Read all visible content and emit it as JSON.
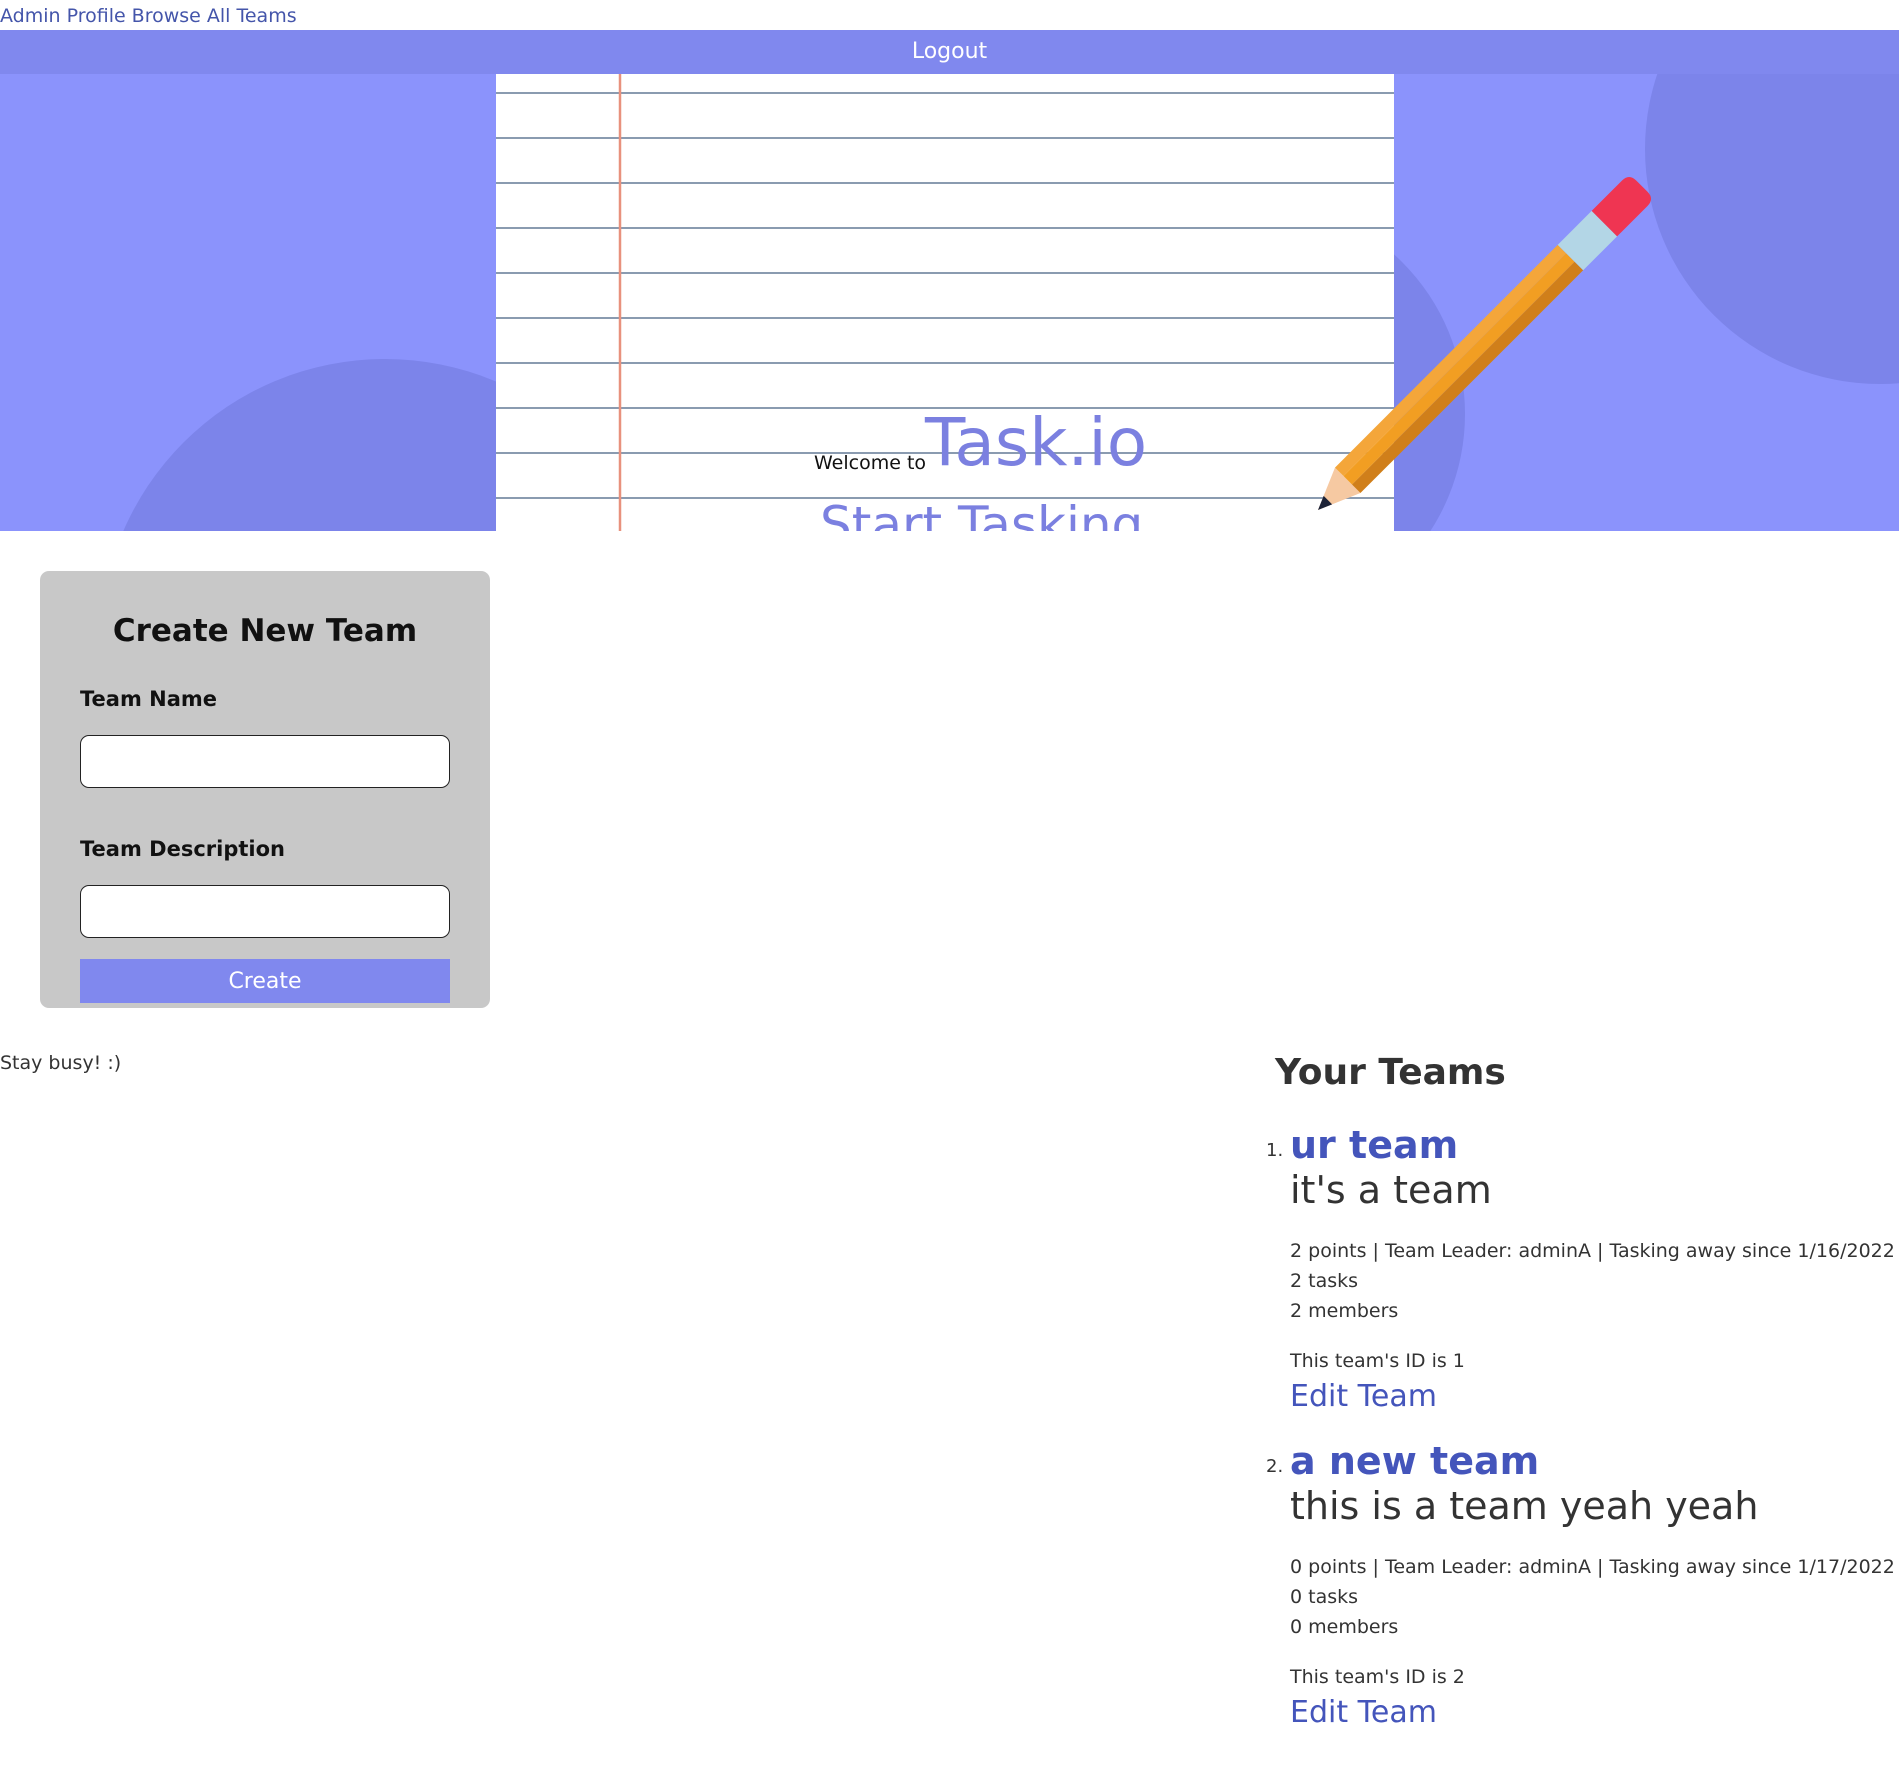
{
  "nav": {
    "profile_label": "Admin Profile",
    "browse_label": "Browse All Teams",
    "logout_label": "Logout"
  },
  "hero": {
    "welcome": "Welcome to",
    "brand": "Task.io",
    "tagline": "Start Tasking"
  },
  "form": {
    "title": "Create New Team",
    "name_label": "Team Name",
    "name_value": "",
    "desc_label": "Team Description",
    "desc_value": "",
    "submit_label": "Create"
  },
  "footer": {
    "text": "Stay busy! :)"
  },
  "teams": {
    "heading": "Your Teams",
    "items": [
      {
        "number": "1.",
        "name": "ur team",
        "description": "it's a team",
        "summary": "2 points | Team Leader: adminA | Tasking away since 1/16/2022",
        "tasks": "2 tasks",
        "members": "2 members",
        "id_text": "This team's ID is 1",
        "edit_label": "Edit Team"
      },
      {
        "number": "2.",
        "name": "a new team",
        "description": "this is a team yeah yeah",
        "summary": "0 points | Team Leader: adminA | Tasking away since 1/17/2022",
        "tasks": "0 tasks",
        "members": "0 members",
        "id_text": "This team's ID is 2",
        "edit_label": "Edit Team"
      }
    ]
  },
  "colors": {
    "accent": "#8088ee",
    "hero_bg": "#8b93fc",
    "link": "#4455bb",
    "card_bg": "#c8c8c8"
  }
}
